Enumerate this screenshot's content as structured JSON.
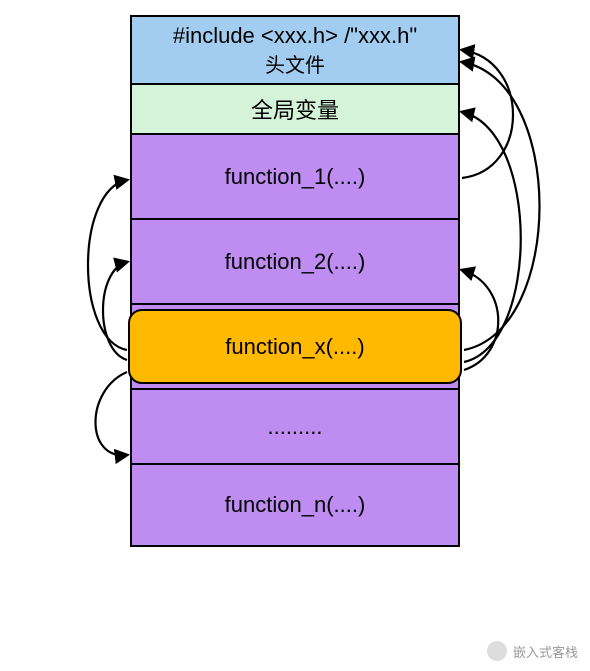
{
  "header": {
    "line1": "#include <xxx.h> /\"xxx.h\"",
    "line2": "头文件"
  },
  "globals": {
    "label": "全局变量"
  },
  "functions": {
    "f1": "function_1(....)",
    "f2": "function_2(....)",
    "fx": "function_x(....)",
    "dots": ".........",
    "fn": "function_n(....)"
  },
  "watermark": {
    "text": "嵌入式客栈"
  }
}
